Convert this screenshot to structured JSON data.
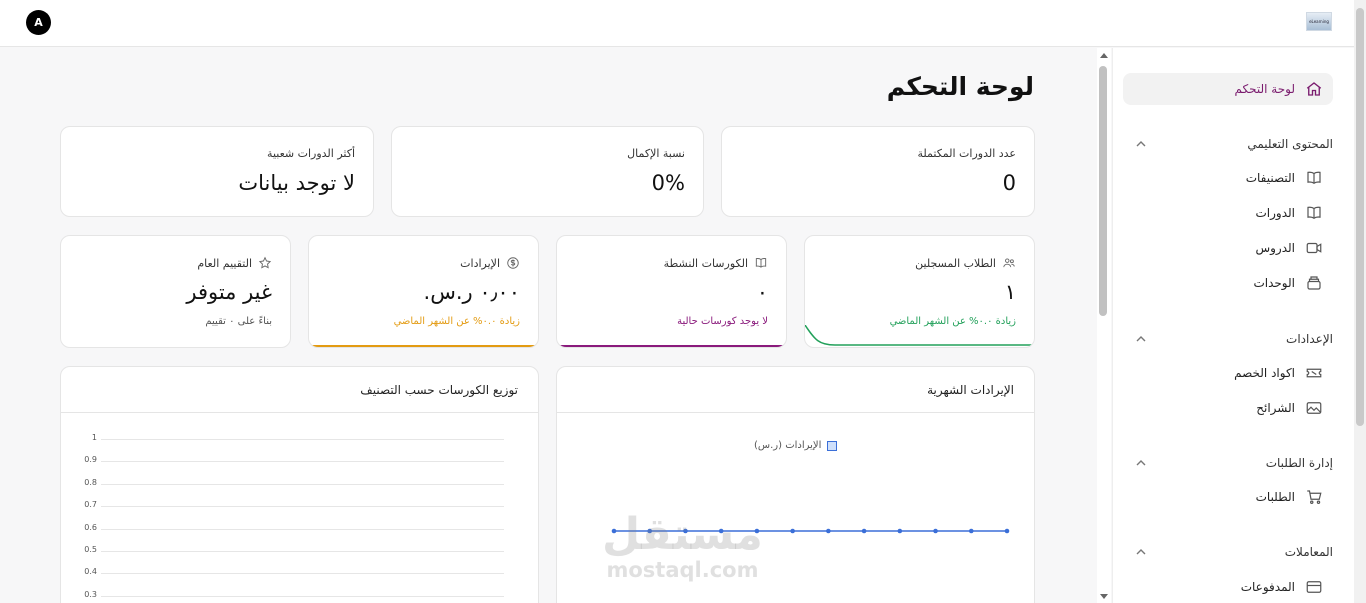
{
  "topbar": {
    "avatar_letter": "A",
    "logo_text": "eLearning"
  },
  "page": {
    "title": "لوحة التحكم"
  },
  "sidebar": {
    "dashboard": "لوحة التحكم",
    "groups": [
      {
        "title": "المحتوى التعليمي",
        "items": [
          {
            "label": "التصنيفات",
            "icon": "book-icon"
          },
          {
            "label": "الدورات",
            "icon": "book-icon"
          },
          {
            "label": "الدروس",
            "icon": "video-icon"
          },
          {
            "label": "الوحدات",
            "icon": "layers-icon"
          }
        ]
      },
      {
        "title": "الإعدادات",
        "items": [
          {
            "label": "اكواد الخصم",
            "icon": "ticket-icon"
          },
          {
            "label": "الشرائح",
            "icon": "image-icon"
          }
        ]
      },
      {
        "title": "إدارة الطلبات",
        "items": [
          {
            "label": "الطلبات",
            "icon": "cart-icon"
          }
        ]
      },
      {
        "title": "المعاملات",
        "items": [
          {
            "label": "المدفوعات",
            "icon": "card-icon"
          }
        ]
      }
    ]
  },
  "stats_top": {
    "completed": {
      "label": "عدد الدورات المكتملة",
      "value": "0"
    },
    "completion": {
      "label": "نسبة الإكمال",
      "value": "0%"
    },
    "popular": {
      "label": "أكثر الدورات شعبية",
      "value": "لا توجد بيانات"
    }
  },
  "stats": {
    "students": {
      "label": "الطلاب المسجلين",
      "value": "١",
      "sub": "زيادة ٠.٠% عن الشهر الماضي",
      "color": "#22a05a"
    },
    "courses": {
      "label": "الكورسات النشطة",
      "value": "٠",
      "sub": "لا يوجد كورسات حالية",
      "color": "#8a1a7c"
    },
    "revenue": {
      "label": "الإيرادات",
      "value": "٠٫٠٠ ر.س.",
      "sub": "زيادة ٠.٠% عن الشهر الماضي",
      "color": "#e39b12"
    },
    "rating": {
      "label": "التقييم العام",
      "value": "غير متوفر",
      "sub": "بناءً على ٠ تقييم"
    }
  },
  "charts": {
    "revenue": {
      "title": "الإيرادات الشهرية"
    },
    "distribution": {
      "title": "توزيع الكورسات حسب التصنيف"
    }
  },
  "chart_data": [
    {
      "type": "line",
      "title": "الإيرادات الشهرية",
      "series": [
        {
          "name": "الإيرادات (ر.س)",
          "values": [
            0,
            0,
            0,
            0,
            0,
            0,
            0,
            0,
            0,
            0,
            0,
            0
          ]
        }
      ],
      "color": "#3b6fd8"
    },
    {
      "type": "bar",
      "title": "توزيع الكورسات حسب التصنيف",
      "ylim": [
        0,
        1
      ],
      "yticks": [
        "1",
        "0.9",
        "0.8",
        "0.7",
        "0.6",
        "0.5",
        "0.4",
        "0.3"
      ],
      "values": []
    }
  ],
  "watermark": {
    "ar": "مستقل",
    "en": "mostaql.com"
  }
}
